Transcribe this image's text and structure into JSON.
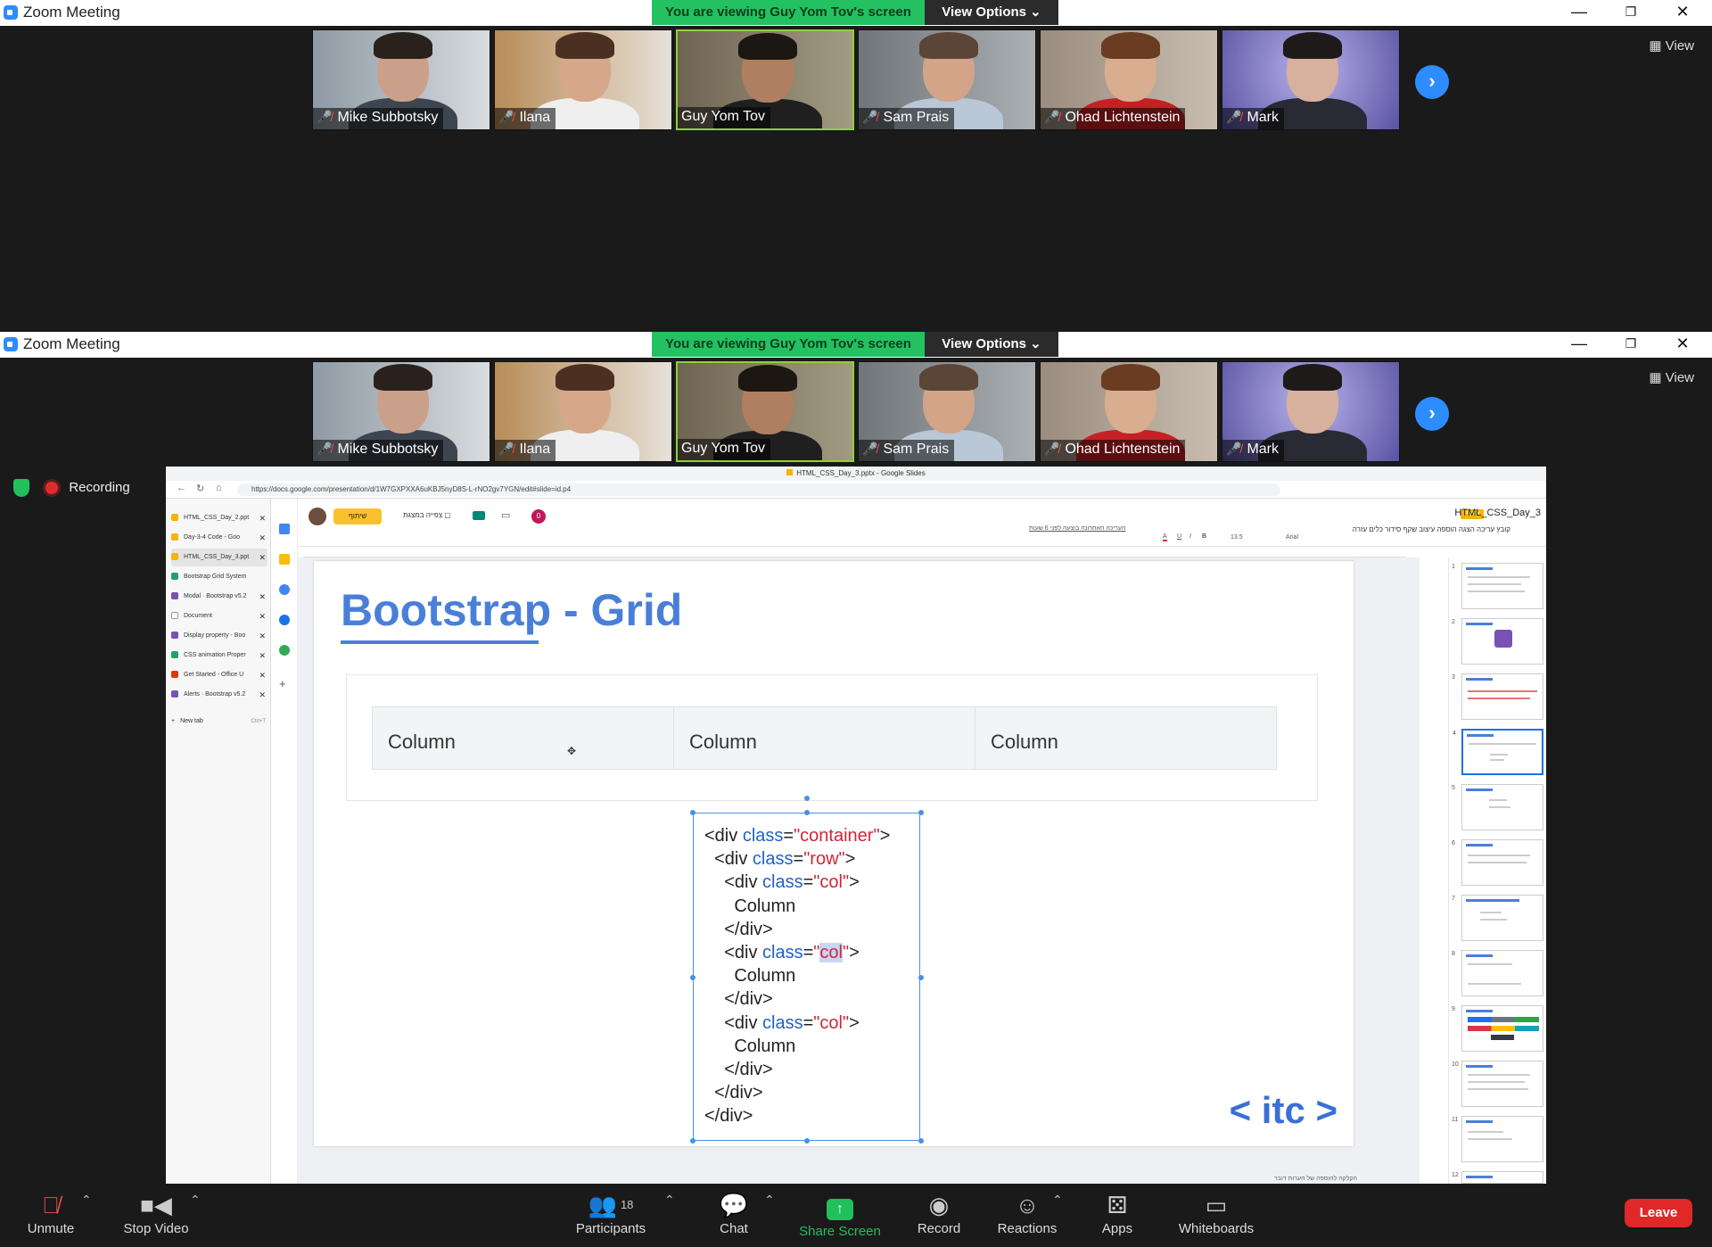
{
  "app": {
    "title": "Zoom Meeting"
  },
  "banner": {
    "text": "You are viewing Guy Yom Tov's screen",
    "view_options": "View Options ⌄"
  },
  "view_label": "View",
  "participants": [
    {
      "name": "Mike Subbotsky",
      "muted": true
    },
    {
      "name": "Ilana",
      "muted": true
    },
    {
      "name": "Guy Yom Tov",
      "muted": false
    },
    {
      "name": "Sam Prais",
      "muted": true
    },
    {
      "name": "Ohad Lichtenstein",
      "muted": true
    },
    {
      "name": "Mark",
      "muted": true
    }
  ],
  "recording": {
    "label": "Recording"
  },
  "browser": {
    "window_title": "HTML_CSS_Day_3.pptx - Google Slides",
    "url": "https://docs.google.com/presentation/d/1W7GXPXXA6uKBJ5nyD8S-L-rNO2gv7YGN/edit#slide=id.p4",
    "tabs": [
      {
        "label": "HTML_CSS_Day_2.ppt",
        "color": "#f4b400"
      },
      {
        "label": "Day-3-4 Code - Goo",
        "color": "#f4b400"
      },
      {
        "label": "HTML_CSS_Day_3.ppt",
        "color": "#f4b400"
      },
      {
        "label": "Bootstrap Grid System",
        "color": "#21a366"
      },
      {
        "label": "Modal · Bootstrap v5.2",
        "color": "#7952b3"
      },
      {
        "label": "Document",
        "color": "#999999"
      },
      {
        "label": "Display property - Boo",
        "color": "#7952b3"
      },
      {
        "label": "CSS animation Proper",
        "color": "#21a366"
      },
      {
        "label": "Get Started - Office U",
        "color": "#d83b01"
      },
      {
        "label": "Alerts · Bootstrap v5.2",
        "color": "#7952b3"
      }
    ],
    "new_tab": "New tab",
    "new_tab_shortcut": "Ctrl+T"
  },
  "slides_app": {
    "doc_name": "HTML_CSS_Day_3",
    "format_badge": "PPTX",
    "share_label": "שיתוף",
    "present_label": "צפייה במצגת",
    "menus": "קובץ  עריכה  הצגה  הוספה  עיצוב  שקף  סידור  כלים  עזרה",
    "last_edit": "העריכה האחרונה בוצעה לפני 6 שעות",
    "font": "Arial",
    "font_size": "13.5",
    "collaborators": "0",
    "speaker_notes": "הקלקה להוספה של הערות דובר"
  },
  "slide": {
    "title": "Bootstrap - Grid",
    "columns": [
      "Column",
      "Column",
      "Column"
    ],
    "code": {
      "l1a": "<div ",
      "l1b": "class",
      "l1c": "=",
      "l1d": "\"container\"",
      "l1e": ">",
      "l2a": "  <div ",
      "l2b": "class",
      "l2c": "=",
      "l2d": "\"row\"",
      "l2e": ">",
      "col_open_a": "    <div ",
      "col_open_b": "class",
      "col_open_c": "=",
      "col_open_d": "\"col\"",
      "col_open_e": ">",
      "col_q1": "\"",
      "col_word": "col",
      "col_q2": "\"",
      "col_text": "      Column",
      "col_close": "    </div>",
      "row_close": "  </div>",
      "container_close": "</div>"
    },
    "logo": "< itc >"
  },
  "thumbnails": [
    "1",
    "2",
    "3",
    "4",
    "5",
    "6",
    "7",
    "8",
    "9",
    "10",
    "11",
    "12"
  ],
  "controls": {
    "unmute": "Unmute",
    "stop_video": "Stop Video",
    "participants": "Participants",
    "participants_count": "18",
    "chat": "Chat",
    "share_screen": "Share Screen",
    "record": "Record",
    "reactions": "Reactions",
    "apps": "Apps",
    "whiteboards": "Whiteboards",
    "leave": "Leave"
  },
  "colors": {
    "banner_green": "#23c161",
    "zoom_blue": "#2d8cff",
    "leave_red": "#e02828",
    "slide_blue": "#4a7fd9"
  }
}
